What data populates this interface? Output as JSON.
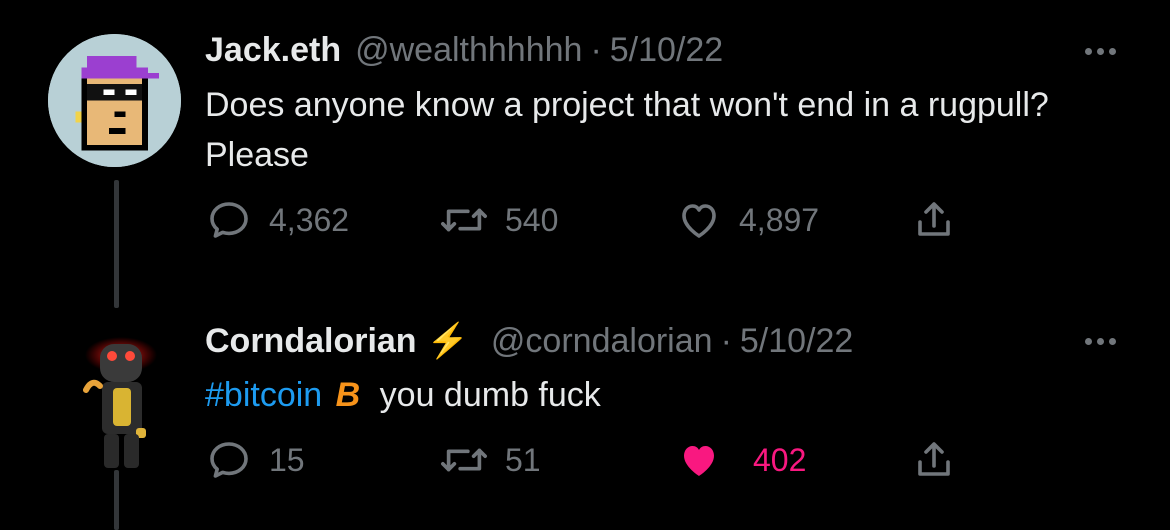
{
  "tweets": [
    {
      "author_name": "Jack.eth",
      "handle": "@wealthhhhhh",
      "separator": "·",
      "date": "5/10/22",
      "text": "Does anyone know a project that won't end in a rugpull? Please",
      "actions": {
        "replies": "4,362",
        "retweets": "540",
        "likes": "4,897",
        "liked": false
      },
      "more_icon": "ellipsis-icon",
      "avatar_icon": "pixel-punk-avatar"
    },
    {
      "author_name": "Corndalorian",
      "name_badge": "⚡",
      "handle": "@corndalorian",
      "separator": "·",
      "date": "5/10/22",
      "hashtag": "#bitcoin",
      "hashtag_emoji": "B",
      "text_rest": "you dumb fuck",
      "actions": {
        "replies": "15",
        "retweets": "51",
        "likes": "402",
        "liked": true
      },
      "more_icon": "ellipsis-icon",
      "avatar_icon": "robot-avatar"
    }
  ],
  "colors": {
    "background": "#000000",
    "text": "#e7e9ea",
    "muted": "#71767b",
    "link": "#1d9bf0",
    "like": "#f91880",
    "bitcoin": "#f7931a"
  }
}
